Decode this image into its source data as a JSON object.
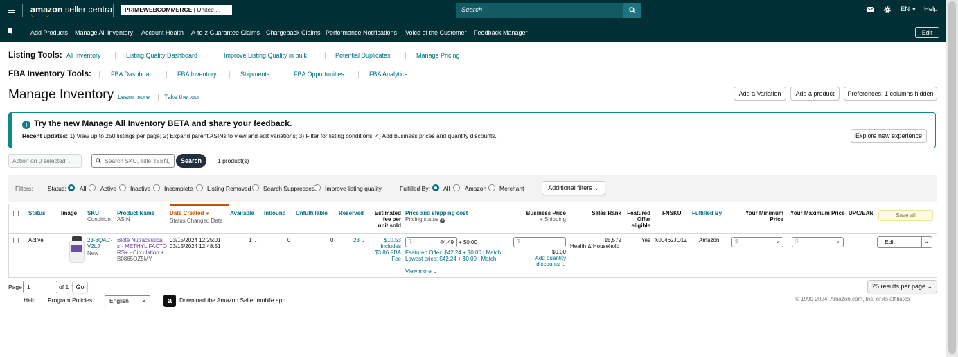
{
  "header": {
    "logo_text_bold": "amazon",
    "logo_text": " seller central",
    "store_bold": "PRIMEWEBCOMMERCE",
    "store_rest": " | United ...",
    "search_placeholder": "Search",
    "language": "EN",
    "help": "Help"
  },
  "nav": {
    "items": [
      "Add Products",
      "Manage All Inventory",
      "Account Health",
      "A-to-z Guarantee Claims",
      "Chargeback Claims",
      "Performance Notifications",
      "Voice of the Customer",
      "Feedback Manager"
    ],
    "edit": "Edit"
  },
  "listing_tools": {
    "label": "Listing Tools:",
    "links": [
      "All Inventory",
      "Listing Quality Dashboard",
      "Improve Listing Quality in bulk",
      "Potential Duplicates",
      "Manage Pricing"
    ]
  },
  "fba_tools": {
    "label": "FBA Inventory Tools:",
    "links": [
      "FBA Dashboard",
      "FBA Inventory",
      "Shipments",
      "FBA Opportunities",
      "FBA Analytics"
    ]
  },
  "page": {
    "title": "Manage Inventory",
    "learn_more": "Learn more",
    "take_tour": "Take the tour",
    "add_variation": "Add a Variation",
    "add_product": "Add a product",
    "preferences": "Preferences: 1 columns hidden"
  },
  "banner": {
    "title": "Try the new Manage All Inventory BETA and share your feedback.",
    "updates_label": "Recent updates:",
    "updates_text": " 1) View up to 250 listings per page; 2) Expand parent ASINs to view and edit variations; 3) Filter for listing conditions; 4) Add business prices and quantity discounts.",
    "button": "Explore new experience"
  },
  "actions": {
    "action_label": "Action on 0 selected",
    "search_placeholder": "Search SKU, Title, ISBN,",
    "search_button": "Search",
    "count": "1 product(s)"
  },
  "filters": {
    "label": "Filters:",
    "status_label": "Status:",
    "status_options": [
      "All",
      "Active",
      "Inactive",
      "Incomplete",
      "Listing Removed",
      "Search Suppressed",
      "Improve listing quality"
    ],
    "status_selected": "All",
    "fulfilled_label": "Fulfilled By:",
    "fulfilled_options": [
      "All",
      "Amazon",
      "Merchant"
    ],
    "fulfilled_selected": "All",
    "additional": "Additional filters"
  },
  "table": {
    "headers": {
      "status": "Status",
      "image": "Image",
      "sku": "SKU",
      "sku_sub": "Condition",
      "product_name": "Product Name",
      "product_sub": "ASIN",
      "date_created": "Date Created",
      "date_sub": "Status Changed Date",
      "available": "Available",
      "inbound": "Inbound",
      "unfulfillable": "Unfulfillable",
      "reserved": "Reserved",
      "est_fee_1": "Estimated",
      "est_fee_2": "fee per",
      "est_fee_3": "unit sold",
      "price": "Price and shipping cost",
      "price_sub": "Pricing status",
      "business_price": "Business Price",
      "business_sub": "+ Shipping",
      "sales_rank": "Sales Rank",
      "featured_1": "Featured",
      "featured_2": "Offer",
      "featured_3": "eligible",
      "fnsku": "FNSKU",
      "fulfilled_by": "Fulfilled By",
      "min_price_1": "Your Minimum",
      "min_price_2": "Price",
      "max_price": "Your Maximum Price",
      "upc": "UPC/EAN",
      "save_all": "Save all"
    },
    "row": {
      "status": "Active",
      "sku_1": "23-3QAC-",
      "sku_2": "V2LJ",
      "condition": "New",
      "name_1": "Biote Nutraceutical",
      "name_2": "s - METHYL FACTO",
      "name_3": "RS+ - Circulation +..",
      "asin": "B0865QZ5MY",
      "date_created": "03/15/2024 12:25:01",
      "date_changed": "03/15/2024 12:48:51",
      "available": "1",
      "inbound": "0",
      "unfulfillable": "0",
      "reserved": "23",
      "fee_1": "$10.53",
      "fee_2": "Includes",
      "fee_3": "$3.86 FBA",
      "fee_4": "Fee",
      "price_currency": "$",
      "price_value": "44.49",
      "price_shipping": "+ $0.00",
      "featured_offer": "Featured Offer: $42.24 + $0.00",
      "lowest_price": "Lowest price: $42.24 + $0.00",
      "match": "Match",
      "view_more": "View more",
      "business_currency": "$",
      "business_shipping": "+ $0.00",
      "add_quantity_1": "Add quantity",
      "add_quantity_2": "discounts",
      "sales_rank": "15,572",
      "sales_category": "Health & Household",
      "featured": "Yes",
      "fnsku": "X00462JO1Z",
      "fulfilled_by": "Amazon",
      "min_currency": "$",
      "max_currency": "$",
      "edit": "Edit"
    }
  },
  "pagination": {
    "page_label": "Page",
    "page_value": "1",
    "of_label": "of 1",
    "go": "Go",
    "per_page": "25 results per page"
  },
  "footer": {
    "help": "Help",
    "policies": "Program Policies",
    "language": "English",
    "app": "Download the Amazon Seller mobile app",
    "copyright": "© 1999-2024, Amazon.com, Inc. or its affiliates"
  }
}
